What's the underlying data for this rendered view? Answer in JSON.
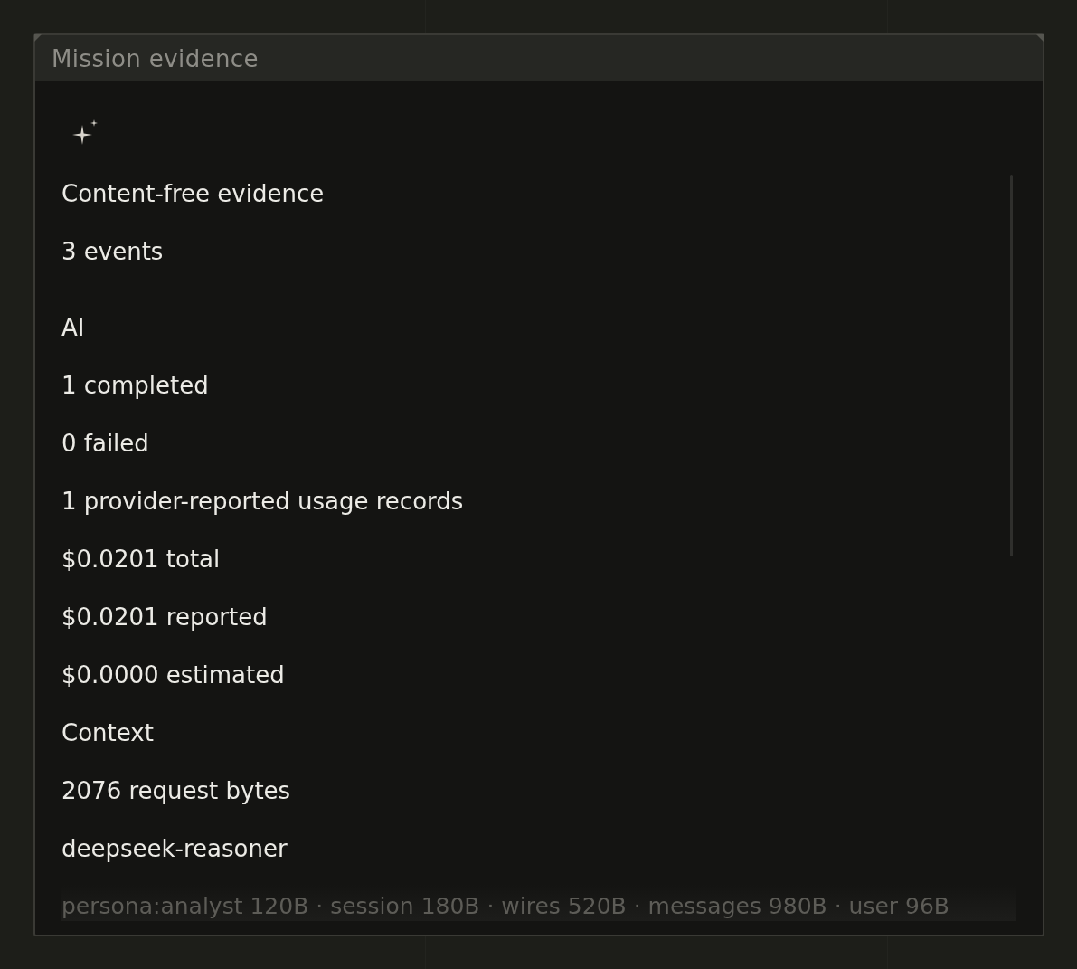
{
  "panel": {
    "title": "Mission evidence"
  },
  "evidence": {
    "heading": "Content-free evidence",
    "count": "3 events"
  },
  "ai": {
    "label": "AI",
    "completed": "1 completed",
    "failed": "0 failed",
    "usage": "1 provider-reported usage records",
    "costs": [
      "$0.0201 total",
      "$0.0201 reported",
      "$0.0000 estimated"
    ]
  },
  "context": {
    "label": "Context",
    "request_bytes": "2076 request bytes",
    "model": "deepseek-reasoner",
    "breakdown": "persona:analyst 120B · session 180B · wires 520B · messages 980B · user 96B"
  }
}
